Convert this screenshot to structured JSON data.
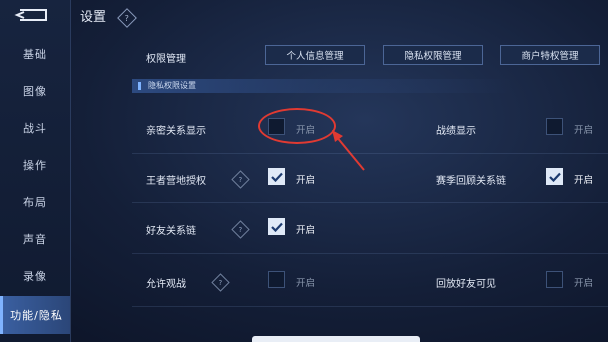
{
  "header": {
    "title": "设置",
    "help_icon": "?"
  },
  "sidebar": {
    "items": [
      {
        "label": "基础"
      },
      {
        "label": "图像"
      },
      {
        "label": "战斗"
      },
      {
        "label": "操作"
      },
      {
        "label": "布局"
      },
      {
        "label": "声音"
      },
      {
        "label": "录像"
      },
      {
        "label": "功能/隐私",
        "active": true
      }
    ]
  },
  "permissions": {
    "label": "权限管理",
    "buttons": [
      "个人信息管理",
      "隐私权限管理",
      "商户特权管理"
    ]
  },
  "section": {
    "title": "隐私权限设置"
  },
  "settings": [
    {
      "label": "亲密关系显示",
      "value": "开启",
      "checked": false,
      "help": false
    },
    {
      "label": "战绩显示",
      "value": "开启",
      "checked": false,
      "help": false
    },
    {
      "label": "王者营地授权",
      "value": "开启",
      "checked": true,
      "help": true
    },
    {
      "label": "赛季回顾关系链",
      "value": "开启",
      "checked": true,
      "help": false
    },
    {
      "label": "好友关系链",
      "value": "开启",
      "checked": true,
      "help": true
    },
    {
      "label": "允许观战",
      "value": "开启",
      "checked": false,
      "help": true
    },
    {
      "label": "回放好友可见",
      "value": "开启",
      "checked": false,
      "help": false
    }
  ],
  "colors": {
    "annotation": "#e03a32",
    "active_nav": "#3a5fa0"
  }
}
